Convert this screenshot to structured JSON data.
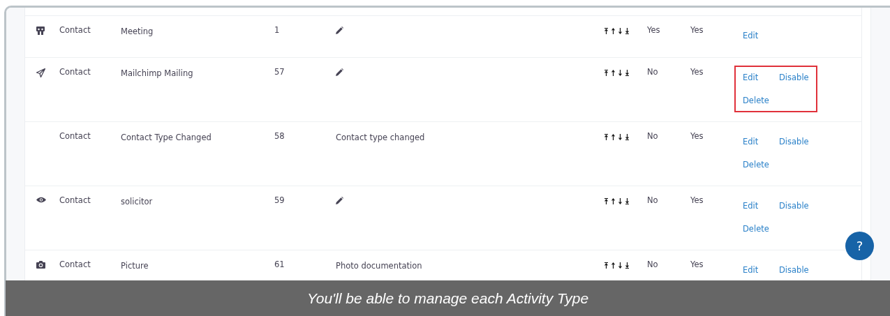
{
  "rows": [
    {
      "kind": "people",
      "type": "Contact",
      "label": "Meeting",
      "value": "1",
      "reserved": "Yes",
      "enabled": "Yes",
      "actions": [
        "Edit"
      ],
      "highlighted": false
    },
    {
      "kind": "paper-plane",
      "type": "Contact",
      "label": "Mailchimp Mailing",
      "value": "57",
      "reserved": "No",
      "enabled": "Yes",
      "actions": [
        "Edit",
        "Disable",
        "Delete"
      ],
      "highlighted": true
    },
    {
      "type": "Contact",
      "label": "Contact Type Changed",
      "value": "58",
      "description": "Contact type changed",
      "reserved": "No",
      "enabled": "Yes",
      "actions": [
        "Edit",
        "Disable",
        "Delete"
      ],
      "highlighted": false
    },
    {
      "kind": "eye",
      "type": "Contact",
      "label": "solicitor",
      "value": "59",
      "reserved": "No",
      "enabled": "Yes",
      "actions": [
        "Edit",
        "Disable",
        "Delete"
      ],
      "highlighted": false
    },
    {
      "kind": "camera",
      "type": "Contact",
      "label": "Picture",
      "value": "61",
      "description": "Photo documentation",
      "reserved": "No",
      "enabled": "Yes",
      "actions": [
        "Edit",
        "Disable"
      ],
      "highlighted": false
    }
  ],
  "help_button": "?",
  "caption": "You'll be able to manage each Activity Type"
}
